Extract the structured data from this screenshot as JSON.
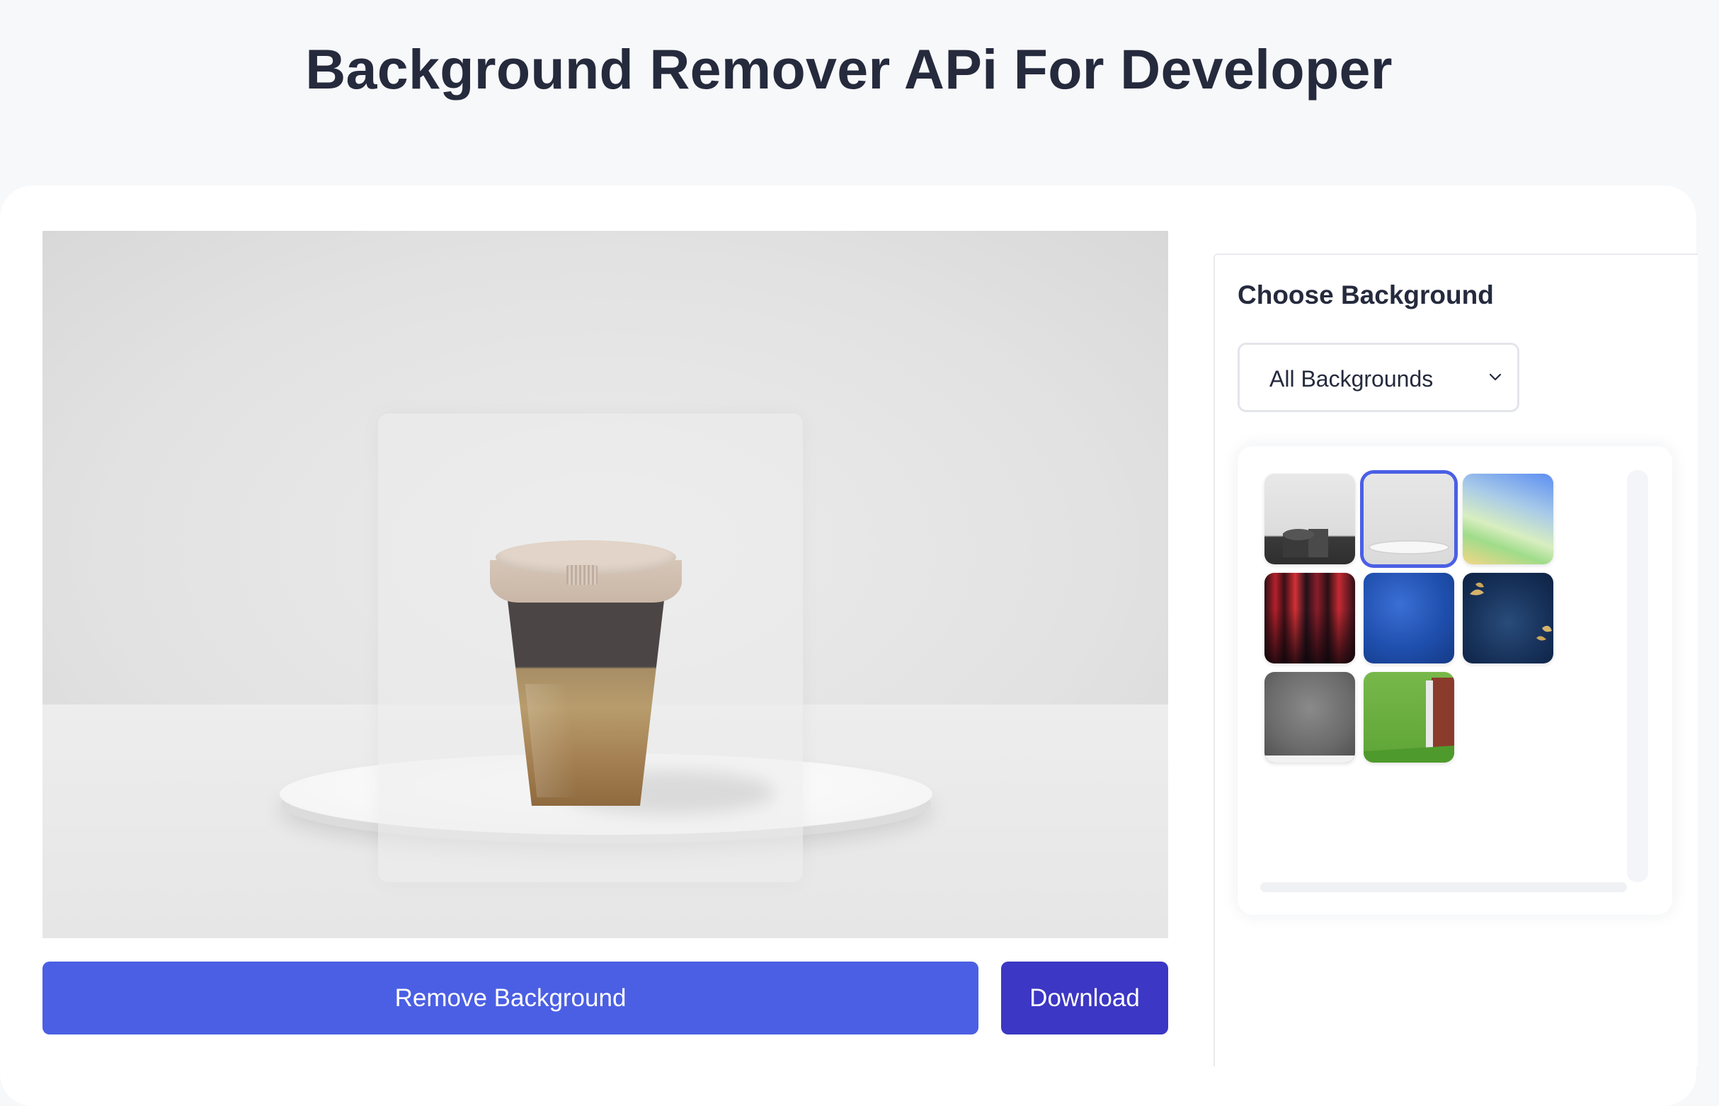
{
  "header": {
    "title": "Background Remover APi For Developer"
  },
  "editor": {
    "remove_label": "Remove Background",
    "download_label": "Download"
  },
  "sidebar": {
    "title": "Choose Background",
    "filter": {
      "selected": "All Backgrounds"
    },
    "thumbnails": [
      {
        "name": "white-wall-cylinders",
        "selected": false
      },
      {
        "name": "white-studio-pedestal",
        "selected": true
      },
      {
        "name": "pastel-gradient",
        "selected": false
      },
      {
        "name": "red-abstract-lines",
        "selected": false
      },
      {
        "name": "blue-gradient",
        "selected": false
      },
      {
        "name": "navy-gold-leaves",
        "selected": false
      },
      {
        "name": "grey-vignette",
        "selected": false
      },
      {
        "name": "green-room-door",
        "selected": false
      }
    ]
  },
  "colors": {
    "primary": "#4b5fe4",
    "download": "#3c37c4",
    "selected_border": "#4b5fe4",
    "text": "#252a3d"
  }
}
